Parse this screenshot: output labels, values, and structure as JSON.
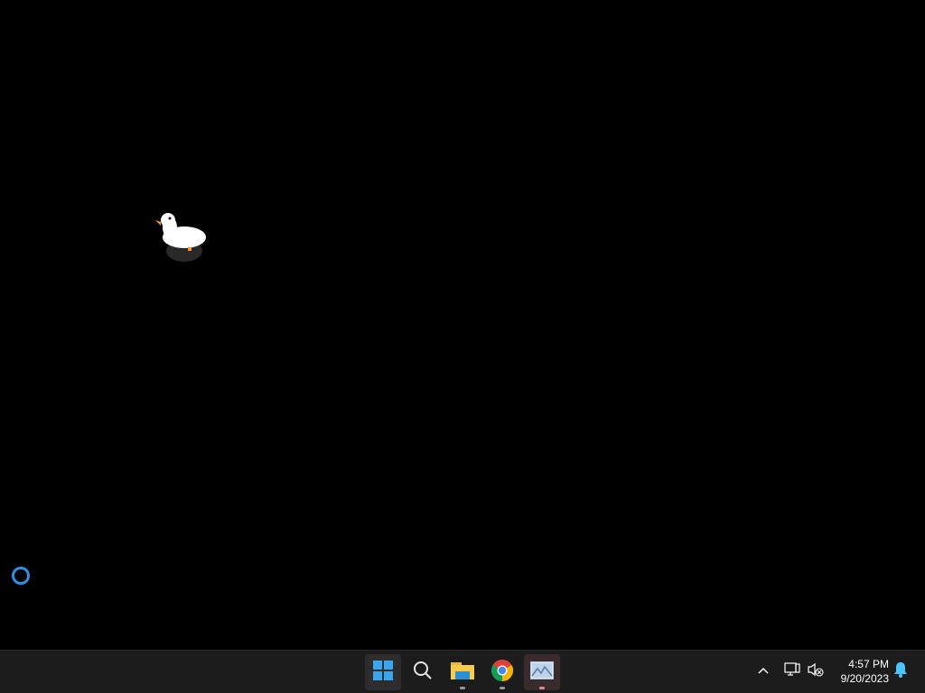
{
  "desktop": {
    "background": "#000000",
    "goose_icon": "goose-icon",
    "busy_cursor_icon": "busy-ring-icon",
    "busy_cursor_color": "#2e8fe6"
  },
  "taskbar": {
    "background": "#1c1c1c",
    "pinned": [
      {
        "name": "start-button",
        "icon": "windows-logo-icon",
        "running": false,
        "active": true
      },
      {
        "name": "search-button",
        "icon": "search-icon",
        "running": false,
        "active": false
      },
      {
        "name": "file-explorer-button",
        "icon": "folder-icon",
        "running": true,
        "active": false
      },
      {
        "name": "chrome-button",
        "icon": "chrome-icon",
        "running": true,
        "active": false
      },
      {
        "name": "app-button",
        "icon": "image-viewer-icon",
        "running": true,
        "active": true
      }
    ],
    "tray": {
      "chevron_icon": "chevron-up-icon",
      "network_icon": "network-icon",
      "volume_icon": "volume-muted-icon",
      "notification_icon": "bell-icon",
      "notification_color": "#4cc2ff"
    },
    "clock": {
      "time": "4:57 PM",
      "date": "9/20/2023"
    }
  }
}
